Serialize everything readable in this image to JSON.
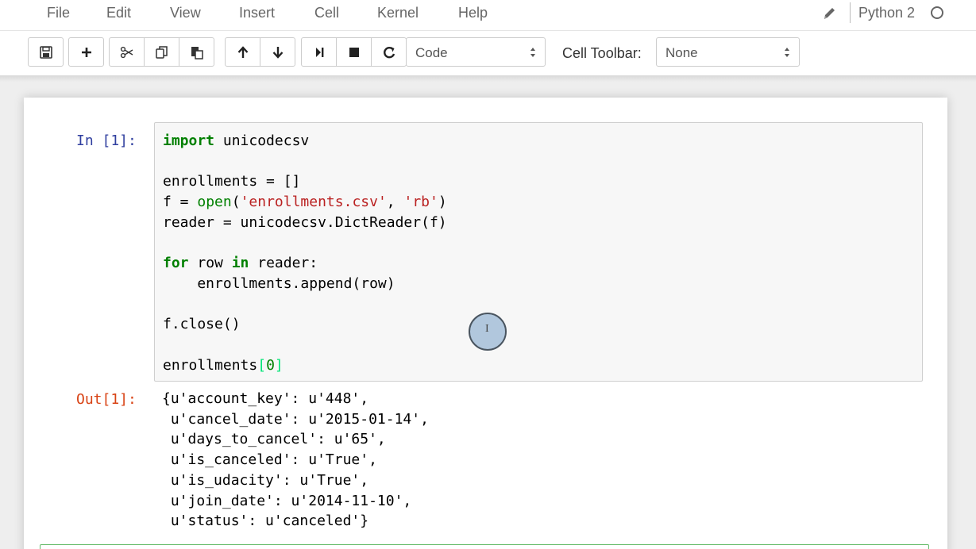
{
  "menubar": {
    "items": [
      "File",
      "Edit",
      "View",
      "Insert",
      "Cell",
      "Kernel",
      "Help"
    ],
    "kernel_name": "Python 2"
  },
  "toolbar": {
    "buttons": [
      "save-icon",
      "plus-icon",
      "scissors-icon",
      "copy-icon",
      "paste-icon",
      "arrow-up-icon",
      "arrow-down-icon",
      "step-icon",
      "stop-icon",
      "restart-icon"
    ],
    "cell_type_select": "Code",
    "cell_toolbar_label": "Cell Toolbar:",
    "cell_toolbar_select": "None"
  },
  "cell": {
    "in_prompt": "In [1]:",
    "out_prompt": "Out[1]:",
    "code": {
      "line1_kw": "import",
      "line1_rest": " unicodecsv",
      "line3": "enrollments = []",
      "line4_a": "f = ",
      "line4_fn": "open",
      "line4_b": "(",
      "line4_s1": "'enrollments.csv'",
      "line4_c": ", ",
      "line4_s2": "'rb'",
      "line4_d": ")",
      "line5": "reader = unicodecsv.DictReader(f)",
      "line7_kw1": "for",
      "line7_mid": " row ",
      "line7_kw2": "in",
      "line7_end": " reader:",
      "line8": "    enrollments.append(row)",
      "line10": "f.close()",
      "line12_a": "enrollments",
      "line12_b": "[",
      "line12_num": "0",
      "line12_c": "]"
    },
    "output": [
      "{u'account_key': u'448',",
      " u'cancel_date': u'2015-01-14',",
      " u'days_to_cancel': u'65',",
      " u'is_canceled': u'True',",
      " u'is_udacity': u'True',",
      " u'join_date': u'2014-11-10',",
      " u'status': u'canceled'}"
    ]
  },
  "cursor_glyph": "I",
  "colors": {
    "in_prompt": "#303f9f",
    "out_prompt": "#d84315",
    "keyword": "#008000",
    "string": "#ba2121",
    "bracket_match": "#00e676"
  }
}
